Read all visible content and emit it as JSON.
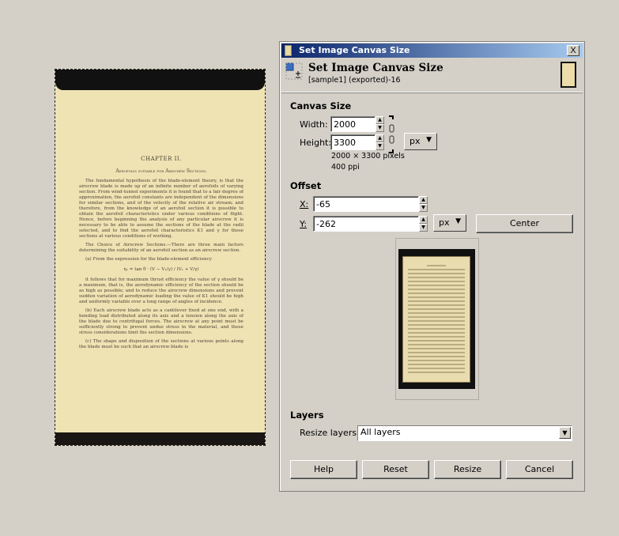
{
  "canvas_image": {
    "chapter": "CHAPTER II.",
    "heading": "Aerofoils suitable for Airscrew Sections.",
    "paragraphs": [
      "The fundamental hypothesis of the blade-element theory, is that the airscrew blade is made up of an infinite number of aerofoils of varying section. From wind-tunnel experiments it is found that to a fair degree of approximation, the aerofoil constants are independent of the dimensions for similar sections, and of the velocity of the relative air stream; and therefore, from the knowledge of an aerofoil section it is possible to obtain the aerofoil characteristics under various conditions of flight. Hence, before beginning the analysis of any particular airscrew it is necessary to be able to assume the sections of the blade at the radii selected, and to find the aerofoil characteristics K1 and γ for these sections at various conditions of working.",
      "The Choice of Airscrew Sections.—There are three main factors determining the suitability of an aerofoil section as an airscrew section.",
      "(a) From the expression for the blade-element efficiency"
    ],
    "equation": "η₁ = tan θ · (V − V₁/γ) / (V₁ + V/γ)",
    "paragraphs2": [
      "it follows that for maximum thrust efficiency the value of γ should be a maximum, that is, the aerodynamic efficiency of the section should be as high as possible; and to reduce the airscrew dimensions and prevent sudden variation of aerodynamic loading the value of K1 should be high and uniformly variable over a long range of angles of incidence.",
      "(b) Each airscrew blade acts as a cantilever fixed at one end, with a bending load distributed along its axis and a tension along the axis of the blade due to centrifugal forces. The airscrew at any point must be sufficiently strong to prevent undue stress in the material, and these stress considerations limit the section dimensions.",
      "(c) The shape and disposition of the sections at various points along the blade must be such that an airscrew blade is"
    ]
  },
  "dialog": {
    "window_title": "Set Image Canvas Size",
    "close_label": "X",
    "header_title": "Set Image Canvas Size",
    "header_subtitle": "[sample1] (exported)-16",
    "canvas_size": {
      "section_label": "Canvas Size",
      "width_label": "Width:",
      "width_value": "2000",
      "height_label": "Height:",
      "height_value": "3300",
      "unit": "px",
      "pixels_info": "2000 × 3300 pixels",
      "ppi_info": "400 ppi"
    },
    "offset": {
      "section_label": "Offset",
      "x_label": "X:",
      "x_value": "-65",
      "y_label": "Y:",
      "y_value": "-262",
      "unit": "px",
      "center_label": "Center"
    },
    "layers": {
      "section_label": "Layers",
      "resize_label": "Resize layers:",
      "resize_value": "All layers"
    },
    "buttons": {
      "help": "Help",
      "reset": "Reset",
      "resize": "Resize",
      "cancel": "Cancel"
    }
  }
}
